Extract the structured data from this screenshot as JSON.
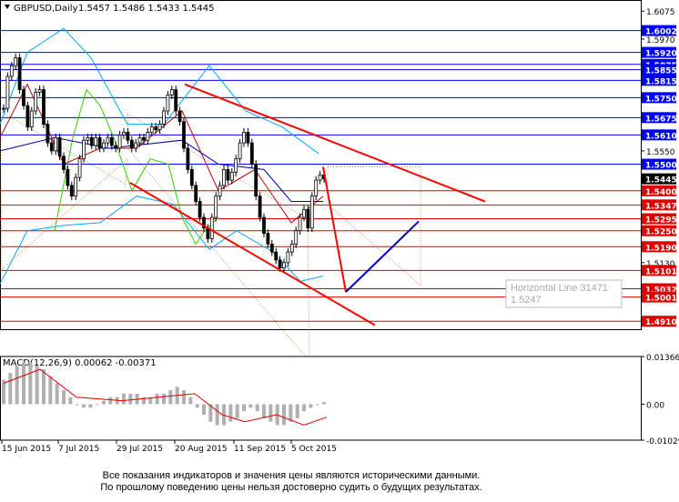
{
  "header": {
    "menu_icon": "triangle-down-icon",
    "title": "GBPUSD,Daily",
    "ohlc": "1.5457 1.5486 1.5433 1.5445"
  },
  "colors": {
    "price_line_blue": "#0000ff",
    "price_line_red": "#e00000",
    "tag_blue": "#0000ff",
    "tag_red": "#e00000",
    "current_tag": "#000000",
    "trend_red": "#ff0000",
    "forecast_blue": "#0000cc",
    "bollinger": "#00aaff",
    "ma_red": "#c00000",
    "ma_blue": "#0000aa",
    "chikou_green": "#33cc00",
    "cloud": "#d08040",
    "macd_hist": "#b0b0b0",
    "macd_signal": "#e00000"
  },
  "price_axis": {
    "ticks": [
      "1.6075",
      "1.5970",
      "1.5550",
      "1.5130",
      "1.5001"
    ]
  },
  "levels": [
    {
      "label": "1.6002",
      "color": "blue"
    },
    {
      "label": "1.5920",
      "color": "blue"
    },
    {
      "label": "1.5875",
      "color": "blue"
    },
    {
      "label": "1.5855",
      "color": "blue"
    },
    {
      "label": "1.5815",
      "color": "blue"
    },
    {
      "label": "1.5750",
      "color": "blue"
    },
    {
      "label": "1.5675",
      "color": "blue"
    },
    {
      "label": "1.5610",
      "color": "blue"
    },
    {
      "label": "1.5500",
      "color": "blue"
    },
    {
      "label": "1.5445",
      "color": "current"
    },
    {
      "label": "1.5400",
      "color": "red"
    },
    {
      "label": "1.5347",
      "color": "red"
    },
    {
      "label": "1.5295",
      "color": "red"
    },
    {
      "label": "1.5250",
      "color": "red"
    },
    {
      "label": "1.5190",
      "color": "red"
    },
    {
      "label": "1.5101",
      "color": "red"
    },
    {
      "label": "1.5032",
      "color": "red"
    },
    {
      "label": "1.5001",
      "color": "red"
    },
    {
      "label": "1.4910",
      "color": "red"
    }
  ],
  "tooltip": {
    "line1": "Horizontal Line 31471",
    "line2": "1.5247"
  },
  "macd": {
    "title": "MACD(12,26,9) 0.00062 -0.00371",
    "ticks": [
      "0.01366",
      "0.00",
      "-0.01029"
    ]
  },
  "time_axis": {
    "labels": [
      "15 Jun 2015",
      "7 Jul 2015",
      "29 Jul 2015",
      "20 Aug 2015",
      "11 Sep 2015",
      "5 Oct 2015"
    ]
  },
  "chart_data": {
    "type": "candlestick",
    "symbol": "GBPUSD",
    "timeframe": "Daily",
    "ohlc_last": {
      "open": 1.5457,
      "high": 1.5486,
      "low": 1.5433,
      "close": 1.5445
    },
    "ylim": [
      1.488,
      1.611
    ],
    "horizontal_levels": [
      1.6002,
      1.592,
      1.5875,
      1.5855,
      1.5815,
      1.575,
      1.5675,
      1.561,
      1.55,
      1.54,
      1.5347,
      1.5295,
      1.525,
      1.519,
      1.5101,
      1.5032,
      1.5001,
      1.491
    ],
    "x_labels": [
      "15 Jun 2015",
      "7 Jul 2015",
      "29 Jul 2015",
      "20 Aug 2015",
      "11 Sep 2015",
      "5 Oct 2015"
    ],
    "close_series": [
      1.571,
      1.583,
      1.587,
      1.59,
      1.578,
      1.572,
      1.564,
      1.57,
      1.577,
      1.578,
      1.565,
      1.558,
      1.555,
      1.56,
      1.553,
      1.548,
      1.542,
      1.538,
      1.545,
      1.552,
      1.559,
      1.56,
      1.557,
      1.56,
      1.556,
      1.558,
      1.56,
      1.557,
      1.556,
      1.561,
      1.562,
      1.559,
      1.556,
      1.558,
      1.56,
      1.559,
      1.562,
      1.564,
      1.563,
      1.565,
      1.57,
      1.576,
      1.578,
      1.57,
      1.566,
      1.556,
      1.548,
      1.542,
      1.536,
      1.53,
      1.526,
      1.522,
      1.53,
      1.538,
      1.542,
      1.548,
      1.544,
      1.547,
      1.552,
      1.558,
      1.562,
      1.558,
      1.55,
      1.538,
      1.53,
      1.524,
      1.52,
      1.517,
      1.514,
      1.511,
      1.513,
      1.517,
      1.52,
      1.525,
      1.53,
      1.533,
      1.526,
      1.538,
      1.544,
      1.546,
      1.5445
    ],
    "channel_upper": [
      [
        1.58,
        1.536
      ]
    ],
    "channel_lower": [
      [
        1.543,
        1.489
      ]
    ],
    "forecast_path": [
      1.549,
      1.502,
      1.5285
    ],
    "macd": {
      "value": 0.00062,
      "signal": -0.00371,
      "ylim": [
        -0.01029,
        0.01366
      ]
    }
  }
}
